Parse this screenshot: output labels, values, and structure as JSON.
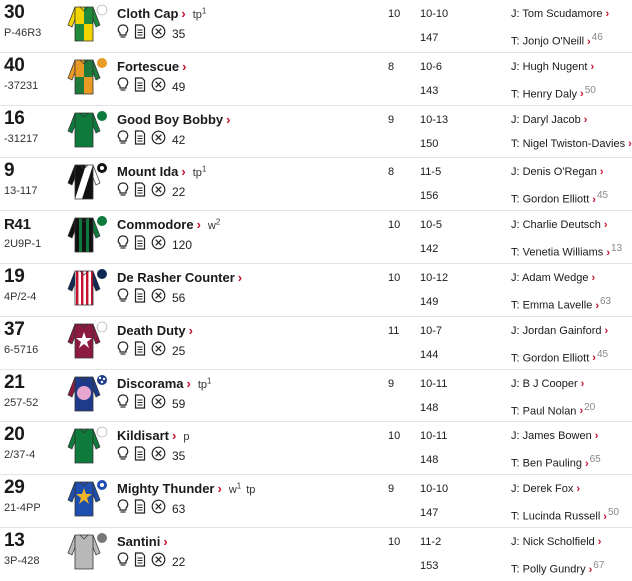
{
  "runners": [
    {
      "number": "30",
      "form": "P-46R3",
      "name": "Cloth Cap",
      "headgear": "tp",
      "headgear_sup": "1",
      "days": "35",
      "age": "10",
      "weight": "10-10",
      "or": "147",
      "jockey": "J: Tom Scudamore",
      "trainer": "T: Jonjo O'Neill",
      "rtf": "46",
      "silk_icon": "silk-green-yellow-quarters-icon"
    },
    {
      "number": "40",
      "form": "-37231",
      "name": "Fortescue",
      "headgear": "",
      "headgear_sup": "",
      "days": "49",
      "age": "8",
      "weight": "10-6",
      "or": "143",
      "jockey": "J: Hugh Nugent",
      "trainer": "T: Henry Daly",
      "rtf": "50",
      "silk_icon": "silk-orange-green-quarters-icon"
    },
    {
      "number": "16",
      "form": "-31217",
      "name": "Good Boy Bobby",
      "headgear": "",
      "headgear_sup": "",
      "days": "42",
      "age": "9",
      "weight": "10-13",
      "or": "150",
      "jockey": "J: Daryl Jacob",
      "trainer": "T: Nigel Twiston-Davies",
      "rtf": "",
      "silk_icon": "silk-green-icon"
    },
    {
      "number": "9",
      "form": "13-117",
      "name": "Mount Ida",
      "headgear": "tp",
      "headgear_sup": "1",
      "days": "22",
      "age": "8",
      "weight": "11-5",
      "or": "156",
      "jockey": "J: Denis O'Regan",
      "trainer": "T: Gordon Elliott",
      "rtf": "45",
      "silk_icon": "silk-black-white-diagonal-icon"
    },
    {
      "number": "R41",
      "form": "2U9P-1",
      "name": "Commodore",
      "headgear": "w",
      "headgear_sup": "2",
      "days": "120",
      "age": "10",
      "weight": "10-5",
      "or": "142",
      "jockey": "J: Charlie Deutsch",
      "trainer": "T: Venetia Williams",
      "rtf": "13",
      "silk_icon": "silk-black-green-stripes-icon"
    },
    {
      "number": "19",
      "form": "4P/2-4",
      "name": "De Rasher Counter",
      "headgear": "",
      "headgear_sup": "",
      "days": "56",
      "age": "10",
      "weight": "10-12",
      "or": "149",
      "jockey": "J: Adam Wedge",
      "trainer": "T: Emma Lavelle",
      "rtf": "63",
      "silk_icon": "silk-red-white-stripes-icon"
    },
    {
      "number": "37",
      "form": "6-5716",
      "name": "Death Duty",
      "headgear": "",
      "headgear_sup": "",
      "days": "25",
      "age": "11",
      "weight": "10-7",
      "or": "144",
      "jockey": "J: Jordan Gainford",
      "trainer": "T: Gordon Elliott",
      "rtf": "45",
      "silk_icon": "silk-maroon-white-star-icon"
    },
    {
      "number": "21",
      "form": "257-52",
      "name": "Discorama",
      "headgear": "tp",
      "headgear_sup": "1",
      "days": "59",
      "age": "9",
      "weight": "10-11",
      "or": "148",
      "jockey": "J: B J Cooper",
      "trainer": "T: Paul Nolan",
      "rtf": "20",
      "silk_icon": "silk-navy-pink-disc-icon"
    },
    {
      "number": "20",
      "form": "2/37-4",
      "name": "Kildisart",
      "headgear": "p",
      "headgear_sup": "",
      "days": "35",
      "age": "10",
      "weight": "10-11",
      "or": "148",
      "jockey": "J: James Bowen",
      "trainer": "T: Ben Pauling",
      "rtf": "65",
      "silk_icon": "silk-green-white-cap-icon"
    },
    {
      "number": "29",
      "form": "21-4PP",
      "name": "Mighty Thunder",
      "headgear": "w",
      "headgear_sup": "1",
      "headgear_extra": "tp",
      "days": "63",
      "age": "9",
      "weight": "10-10",
      "or": "147",
      "jockey": "J: Derek Fox",
      "trainer": "T: Lucinda Russell",
      "rtf": "50",
      "silk_icon": "silk-royal-blue-gold-star-icon"
    },
    {
      "number": "13",
      "form": "3P-428",
      "name": "Santini",
      "headgear": "",
      "headgear_sup": "",
      "days": "22",
      "age": "10",
      "weight": "11-2",
      "or": "153",
      "jockey": "J: Nick Scholfield",
      "trainer": "T: Polly Gundry",
      "rtf": "67",
      "silk_icon": "silk-grey-icon"
    }
  ],
  "colors": {
    "accent": "#c8102e",
    "divider": "#e4e4e4"
  },
  "row_icons": [
    "lightbulb-icon",
    "form-guide-icon",
    "days-since-run-icon"
  ]
}
